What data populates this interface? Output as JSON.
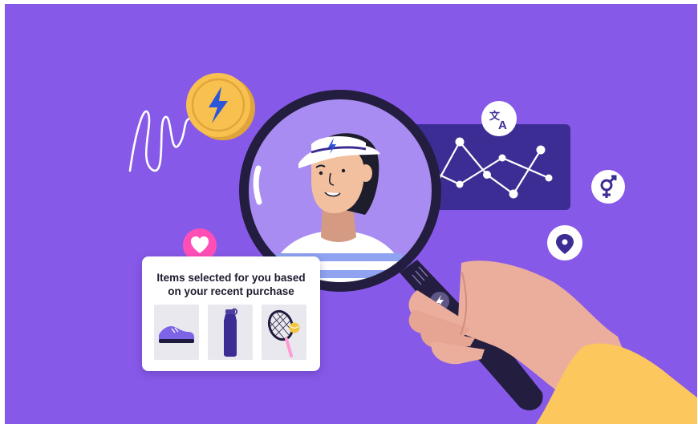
{
  "illustration": {
    "card": {
      "title_line1": "Items selected for you based",
      "title_line2": "on your recent purchase",
      "products": [
        {
          "name": "sneaker"
        },
        {
          "name": "water-bottle"
        },
        {
          "name": "tennis-racket"
        }
      ]
    },
    "icons": [
      "lightning-coin-icon",
      "heart-icon",
      "translate-icon",
      "gender-icon",
      "location-pin-icon",
      "magnifier-lightning-icon"
    ],
    "colors": {
      "background": "#8759e8",
      "accent_dark": "#3c2d94",
      "coin": "#f8c14f",
      "heart": "#ff4fb7",
      "hand": "#ecae9c",
      "sleeve": "#fcc75c"
    }
  }
}
